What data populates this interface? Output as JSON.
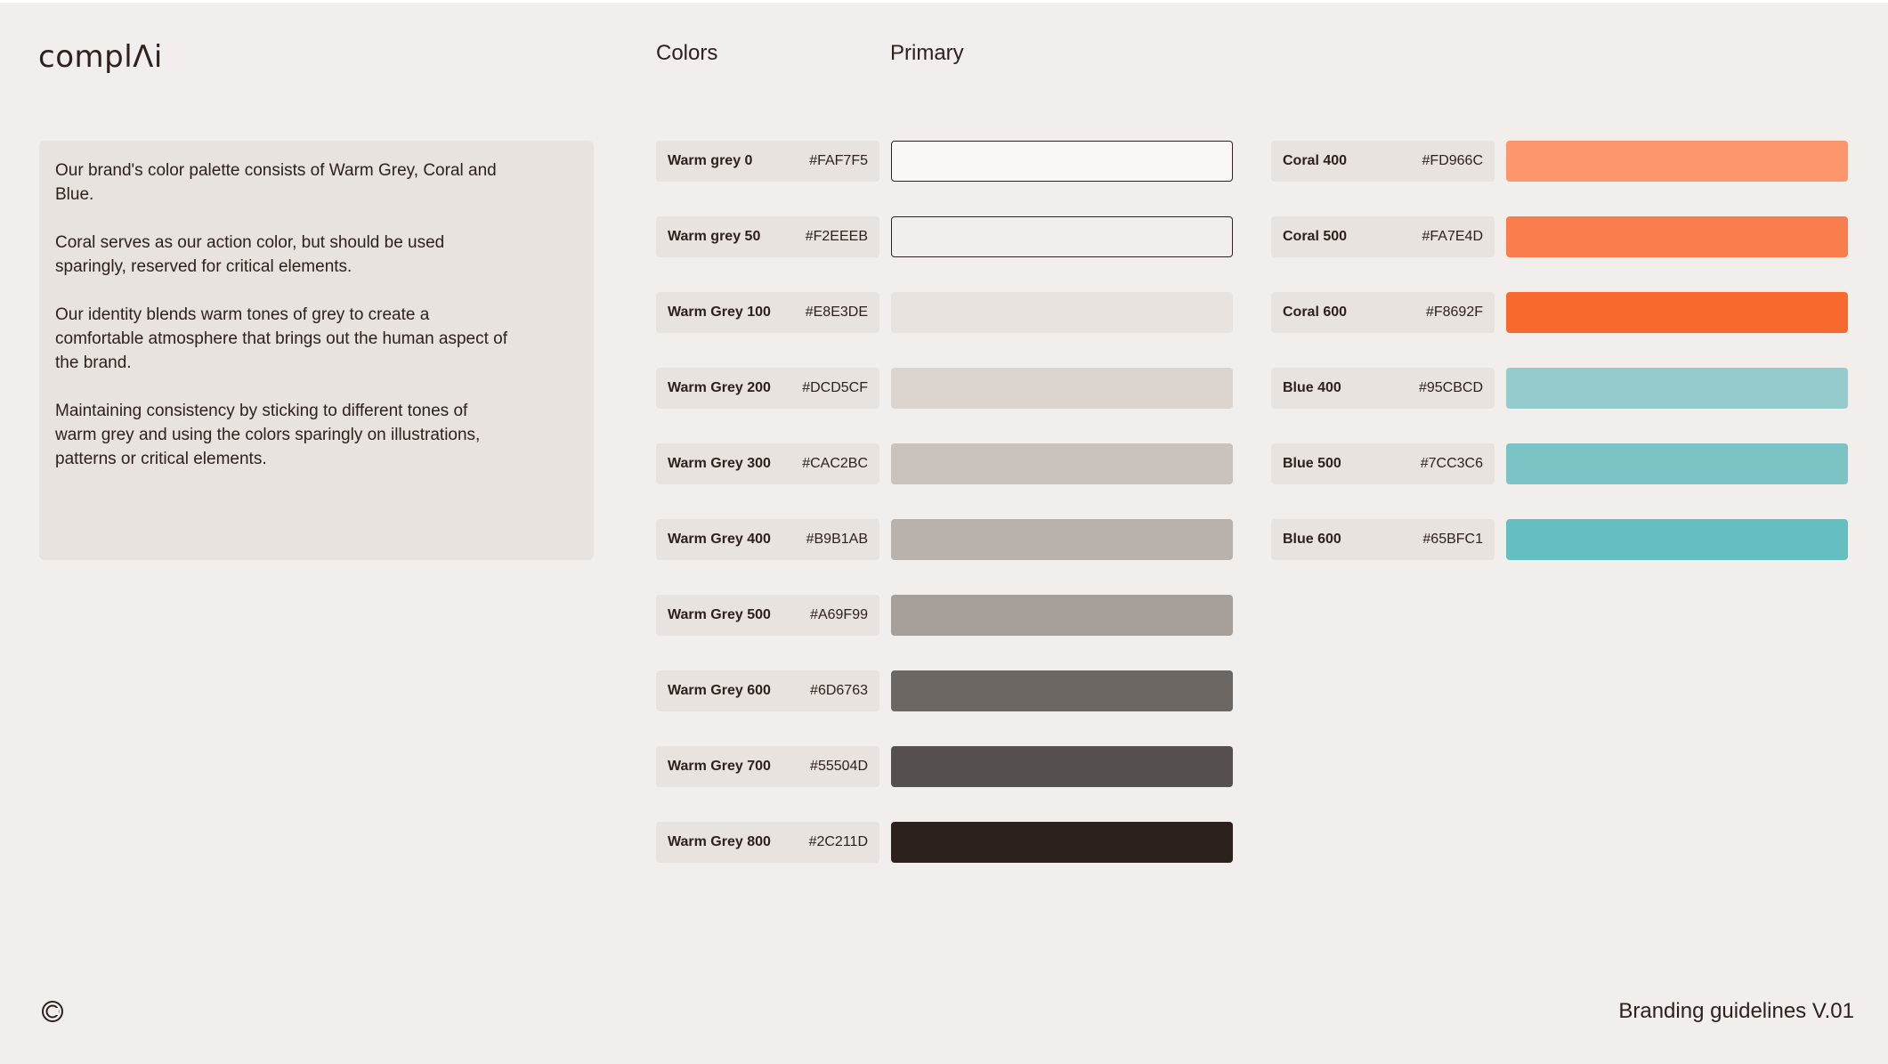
{
  "header": {
    "logo_text": "complΛi",
    "colors_title": "Colors",
    "primary_title": "Primary"
  },
  "description": {
    "paragraphs": [
      "Our brand's color palette consists of Warm Grey, Coral and Blue.",
      "Coral serves as our action color, but should be used sparingly, reserved for critical elements.",
      "Our identity blends warm tones of grey to create a comfortable atmosphere that brings out the human aspect of the brand.",
      "Maintaining consistency by sticking to different tones of warm grey and using the colors sparingly on illustrations, patterns or critical elements."
    ]
  },
  "warm_greys": [
    {
      "name": "Warm grey 0",
      "hex": "#FAF7F5"
    },
    {
      "name": "Warm grey 50",
      "hex": "#F2EEEB"
    },
    {
      "name": "Warm Grey 100",
      "hex": "#E8E3DE"
    },
    {
      "name": "Warm Grey 200",
      "hex": "#DCD5CF"
    },
    {
      "name": "Warm Grey 300",
      "hex": "#CAC2BC"
    },
    {
      "name": "Warm Grey 400",
      "hex": "#B9B1AB"
    },
    {
      "name": "Warm Grey 500",
      "hex": "#A69F99"
    },
    {
      "name": "Warm Grey 600",
      "hex": "#6D6763"
    },
    {
      "name": "Warm Grey 700",
      "hex": "#55504D"
    },
    {
      "name": "Warm Grey 800",
      "hex": "#2C211D"
    }
  ],
  "accents": [
    {
      "name": "Coral 400",
      "hex": "#FD966C"
    },
    {
      "name": "Coral 500",
      "hex": "#FA7E4D"
    },
    {
      "name": "Coral 600",
      "hex": "#F8692F"
    },
    {
      "name": "Blue 400",
      "hex": "#95CBCD"
    },
    {
      "name": "Blue 500",
      "hex": "#7CC3C6"
    },
    {
      "name": "Blue 600",
      "hex": "#65BFC1"
    }
  ],
  "footer": {
    "icon": "copyright-icon",
    "text": "Branding guidelines V.01"
  }
}
